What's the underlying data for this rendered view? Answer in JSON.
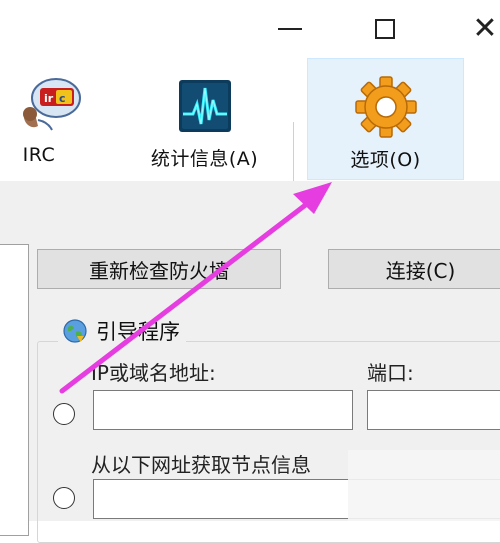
{
  "window": {
    "minimize_icon": "minimize-icon",
    "maximize_icon": "maximize-icon",
    "close_icon": "close-icon"
  },
  "toolbar": {
    "items": [
      {
        "label": "IRC",
        "icon": "irc-icon"
      },
      {
        "label": "统计信息(A)",
        "icon": "statistics-icon"
      },
      {
        "label": "选项(O)",
        "icon": "options-gear-icon",
        "selected": true
      }
    ]
  },
  "main": {
    "recheck_firewall_button": "重新检查防火墙",
    "connect_button": "连接(C)",
    "bootstrap": {
      "title": "引导程序",
      "ip_label": "IP或域名地址:",
      "port_label": "端口:",
      "ip_value": "",
      "port_value": "",
      "url_label": "从以下网址获取节点信息",
      "url_value": ""
    }
  },
  "colors": {
    "arrow": "#e63de0",
    "selected_tab_bg": "#e5f1fb",
    "panel_bg": "#f0f0f0"
  }
}
